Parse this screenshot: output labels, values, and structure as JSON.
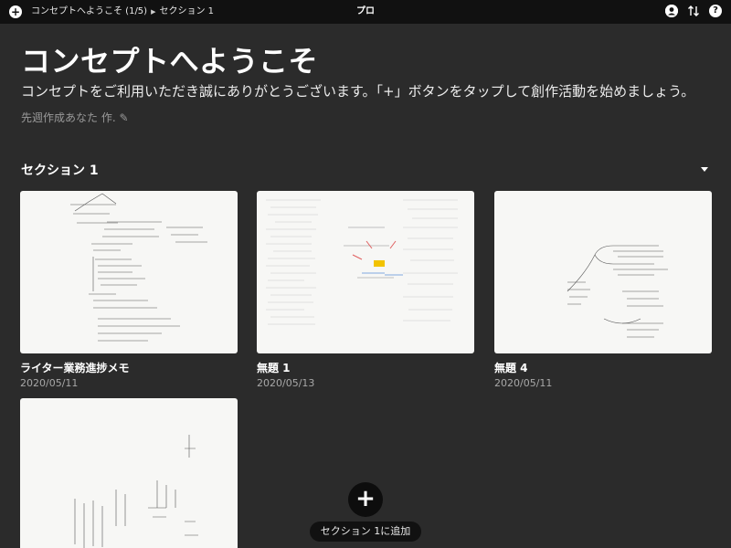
{
  "topbar": {
    "breadcrumb_doc": "コンセプトへようこそ (1/5)",
    "breadcrumb_section": "セクション 1",
    "center_title": "プロ"
  },
  "hero": {
    "title": "コンセプトへようこそ",
    "subtitle": "コンセプトをご利用いただき誠にありがとうございます。「+」ボタンをタップして創作活動を始めましょう。",
    "author_line": "先週作成あなた 作. ✎"
  },
  "section": {
    "title": "セクション 1"
  },
  "cards": [
    {
      "title": "ライター業務進捗メモ",
      "date": "2020/05/11"
    },
    {
      "title": "無題 1",
      "date": "2020/05/13"
    },
    {
      "title": "無題 4",
      "date": "2020/05/11"
    },
    {
      "title": "",
      "date": ""
    }
  ],
  "add_button": {
    "symbol": "+",
    "label": "セクション 1に追加"
  },
  "icons": {
    "top_left": "add-circle-icon",
    "crumb_sep": "triangle-right-icon",
    "profile": "profile-icon",
    "sort": "sort-icon",
    "help": "help-icon",
    "edit": "pencil-icon",
    "section_toggle": "chevron-down-icon"
  },
  "colors": {
    "background": "#2b2b2b",
    "topbar": "#111111",
    "card": "#f7f7f5"
  }
}
